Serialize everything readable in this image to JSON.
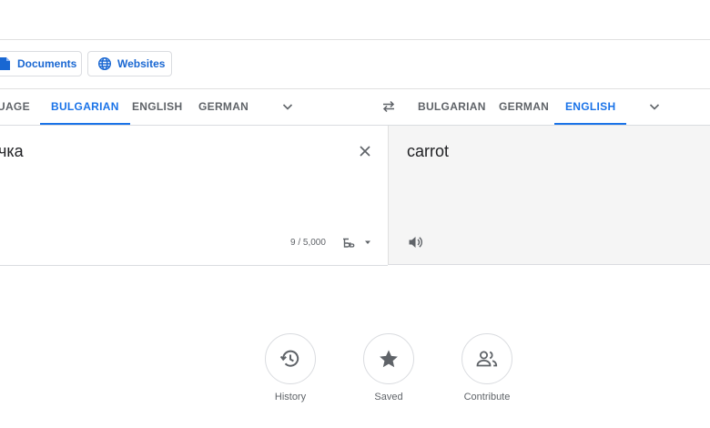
{
  "modes": {
    "documents_label": "Documents",
    "websites_label": "Websites"
  },
  "source_languages": [
    {
      "label": "UAGE",
      "active": false
    },
    {
      "label": "BULGARIAN",
      "active": true
    },
    {
      "label": "ENGLISH",
      "active": false
    },
    {
      "label": "GERMAN",
      "active": false
    }
  ],
  "target_languages": [
    {
      "label": "BULGARIAN",
      "active": false
    },
    {
      "label": "GERMAN",
      "active": false
    },
    {
      "label": "ENGLISH",
      "active": true
    }
  ],
  "source": {
    "text": "чка",
    "char_count": "9 / 5,000"
  },
  "target": {
    "text": "carrot"
  },
  "quick_actions": [
    {
      "label": "History",
      "icon": "history-icon"
    },
    {
      "label": "Saved",
      "icon": "star-icon"
    },
    {
      "label": "Contribute",
      "icon": "people-icon"
    }
  ],
  "colors": {
    "accent": "#1a73e8",
    "text": "#202124",
    "muted": "#5f6368"
  }
}
